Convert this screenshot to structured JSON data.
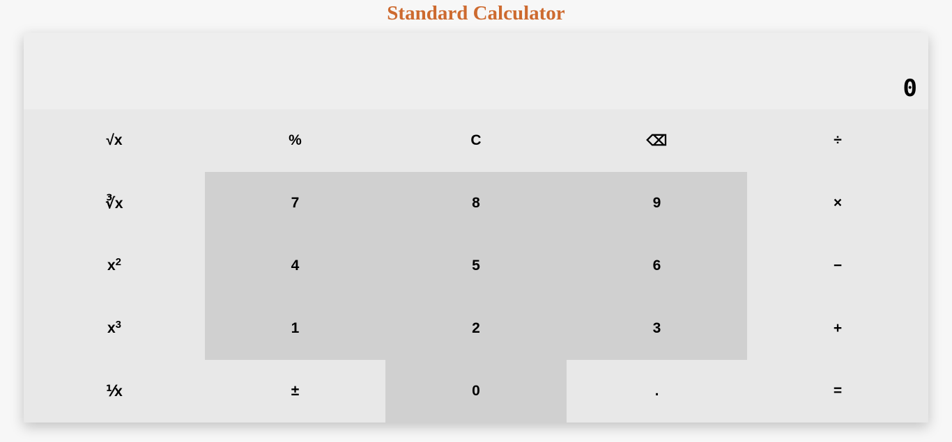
{
  "title": "Standard Calculator",
  "display": {
    "value": "0"
  },
  "keys": {
    "sqrt": "√x",
    "percent": "%",
    "clear": "C",
    "backspace": "⌫",
    "divide": "÷",
    "cbrt": "∛x",
    "seven": "7",
    "eight": "8",
    "nine": "9",
    "multiply": "×",
    "square_base": "x",
    "square_exp": "2",
    "four": "4",
    "five": "5",
    "six": "6",
    "subtract": "−",
    "cube_base": "x",
    "cube_exp": "3",
    "one": "1",
    "two": "2",
    "three": "3",
    "add": "+",
    "reciprocal": "⅟x",
    "negate": "±",
    "zero": "0",
    "decimal": ".",
    "equals": "="
  },
  "colors": {
    "title": "#cd6a2f",
    "display_bg": "#eeeeee",
    "function_key_bg": "#e8e8e8",
    "digit_key_bg": "#d0d0d0"
  }
}
